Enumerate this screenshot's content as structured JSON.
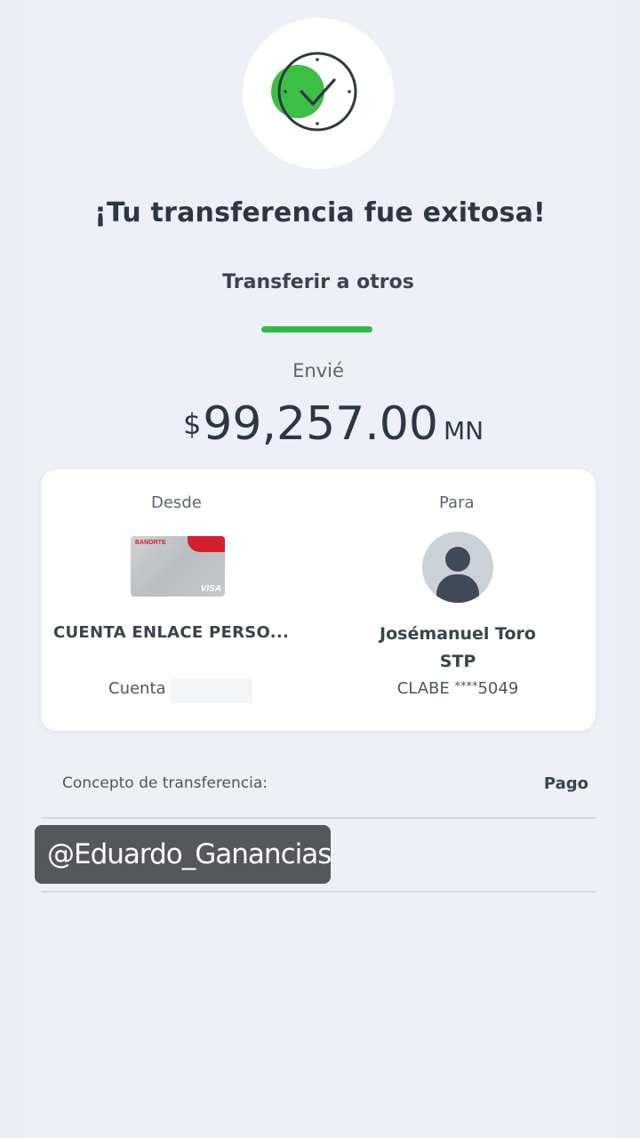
{
  "header": {
    "title": "¡Tu transferencia fue exitosa!",
    "subtitle": "Transferir a otros"
  },
  "transfer": {
    "sent_label": "Envié",
    "currency_symbol": "$",
    "amount": "99,257.00",
    "currency_code": "MN"
  },
  "from": {
    "label": "Desde",
    "card_brand": "BANORTE",
    "card_network": "VISA",
    "account_name": "CUENTA ENLACE PERSO...",
    "account_label": "Cuenta"
  },
  "to": {
    "label": "Para",
    "name": "Josémanuel Toro",
    "bank": "STP",
    "clabe_label": "CLABE",
    "clabe_mask": "****",
    "clabe_last": "5049"
  },
  "concept": {
    "label": "Concepto de transferencia:",
    "value": "Pago",
    "partial_hidden": "4"
  },
  "watermark": {
    "text": "@Eduardo_Ganancias"
  },
  "colors": {
    "accent_green": "#2fbb4a",
    "background": "#eaedf4",
    "text_dark": "#2c3744"
  },
  "icons": {
    "success": "clock-check-icon",
    "avatar": "user-avatar-icon"
  }
}
